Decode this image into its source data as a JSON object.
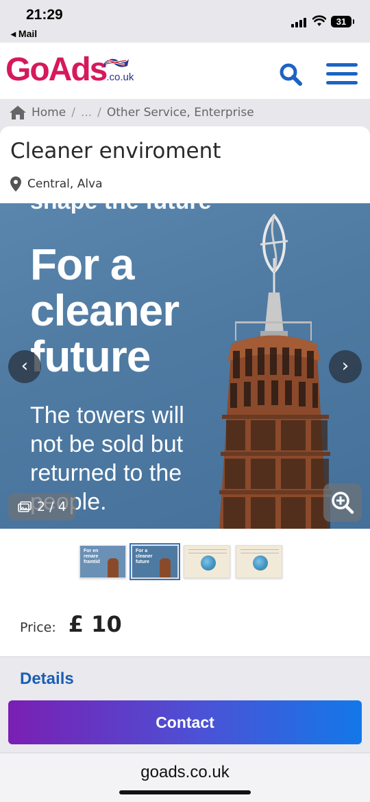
{
  "status_bar": {
    "time": "21:29",
    "back_app": "◂ Mail",
    "battery": "31"
  },
  "header": {
    "logo_main": "GoAds",
    "logo_suffix": ".co.uk",
    "search_icon": "search-icon",
    "menu_icon": "hamburger-menu-icon",
    "brand_color": "#e0103c",
    "accent_color": "#1c63c4"
  },
  "breadcrumb": {
    "home": "Home",
    "sep1": "/",
    "ellipsis": "...",
    "sep2": "/",
    "current": "Other Service, Enterprise"
  },
  "listing": {
    "title": "Cleaner enviroment",
    "location": "Central, Alva",
    "price_label": "Price:",
    "price_value": "£ 10"
  },
  "gallery": {
    "slide_top_cut": "shape the future",
    "slide_headline": "For a cleaner future",
    "slide_subtext": "The towers will not be sold but returned to the people.",
    "counter": "2 / 4",
    "prev_icon": "chevron-left-icon",
    "next_icon": "chevron-right-icon",
    "zoom_icon": "zoom-in-icon",
    "thumbnails": [
      {
        "caption": "For en renare framtid"
      },
      {
        "caption": "For a cleaner future"
      },
      {
        "caption": ""
      },
      {
        "caption": ""
      }
    ]
  },
  "actions": {
    "details": "Details",
    "contact": "Contact"
  },
  "browser": {
    "url": "goads.co.uk"
  }
}
